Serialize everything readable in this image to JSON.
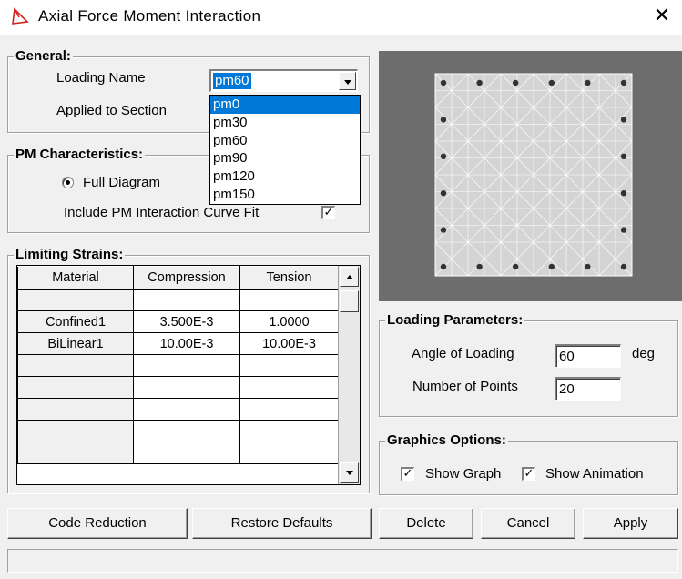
{
  "window": {
    "title": "Axial Force Moment Interaction",
    "close_glyph": "✕"
  },
  "general": {
    "title": "General:",
    "loading_name_label": "Loading Name",
    "loading_name_value": "pm60",
    "applied_to_section_label": "Applied to Section",
    "dropdown_options": [
      "pm0",
      "pm30",
      "pm60",
      "pm90",
      "pm120",
      "pm150"
    ],
    "dropdown_highlighted": "pm0"
  },
  "pm": {
    "title": "PM Characteristics:",
    "full_diagram_label": "Full Diagram",
    "full_diagram_selected": true,
    "curve_fit_label": "Include PM Interaction Curve Fit",
    "curve_fit_checked": true
  },
  "strains": {
    "title": "Limiting Strains:",
    "columns": [
      "Material",
      "Compression",
      "Tension"
    ],
    "rows": [
      [
        "",
        "",
        ""
      ],
      [
        "Confined1",
        "3.500E-3",
        "1.0000"
      ],
      [
        "BiLinear1",
        "10.00E-3",
        "10.00E-3"
      ],
      [
        "",
        "",
        ""
      ],
      [
        "",
        "",
        ""
      ],
      [
        "",
        "",
        ""
      ],
      [
        "",
        "",
        ""
      ],
      [
        "",
        "",
        ""
      ]
    ]
  },
  "loading": {
    "title": "Loading Parameters:",
    "angle_label": "Angle of Loading",
    "angle_value": "60",
    "angle_unit": "deg",
    "points_label": "Number of Points",
    "points_value": "20"
  },
  "graphics": {
    "title": "Graphics Options:",
    "show_graph_label": "Show Graph",
    "show_graph_checked": true,
    "show_animation_label": "Show Animation",
    "show_animation_checked": true
  },
  "buttons": {
    "code_reduction": "Code Reduction",
    "restore_defaults": "Restore Defaults",
    "delete": "Delete",
    "cancel": "Cancel",
    "apply": "Apply"
  },
  "check_glyph": "✓",
  "colors": {
    "highlight": "#0078d7",
    "preview_bg": "#6d6d6d",
    "section_fill": "#d4d4d4",
    "rebar": "#333333"
  }
}
